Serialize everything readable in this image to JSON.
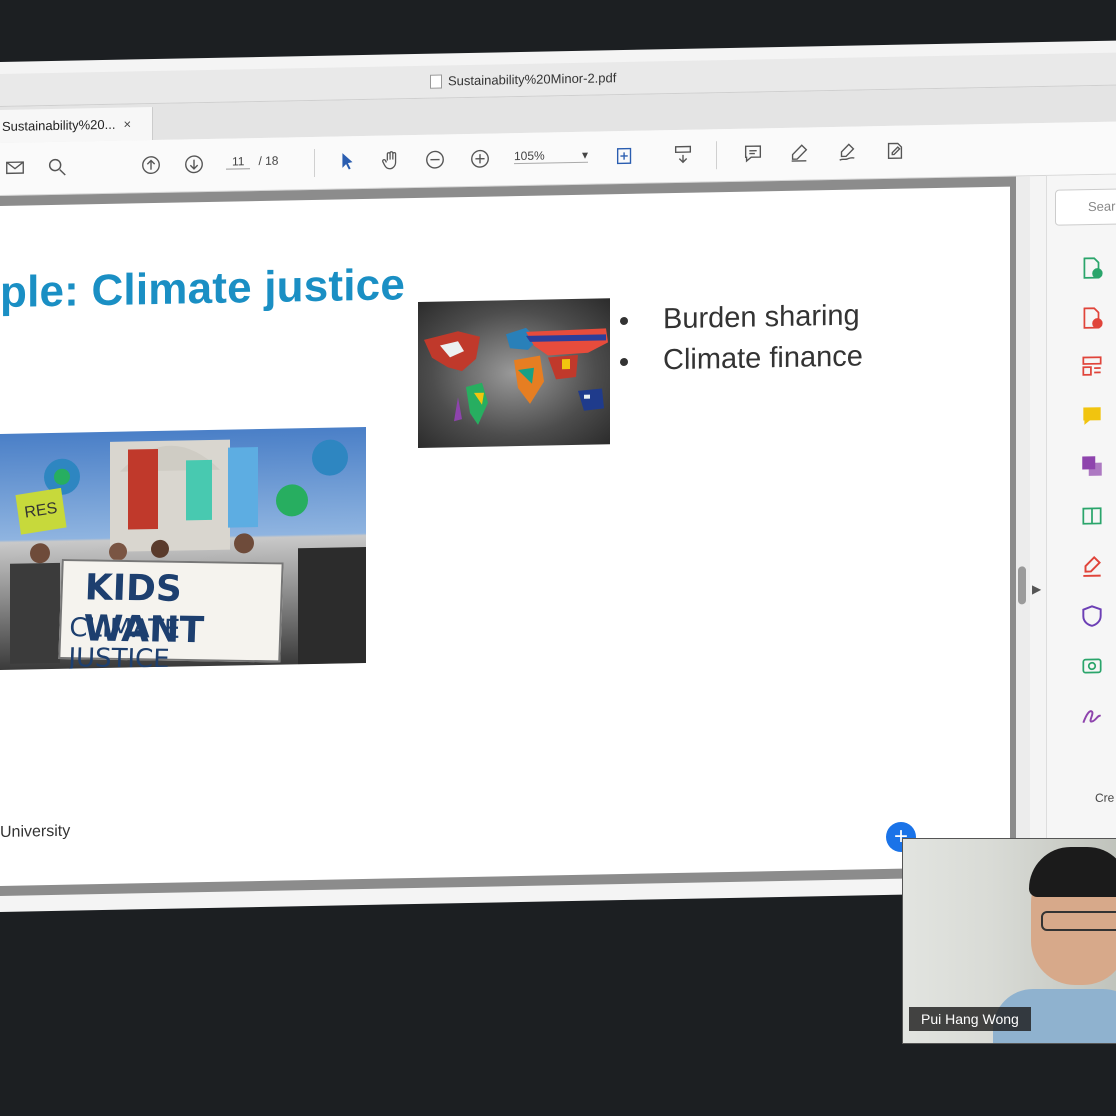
{
  "window": {
    "title": "Sustainability%20Minor-2.pdf"
  },
  "tab": {
    "label": "Sustainability%20...",
    "close": "×"
  },
  "toolbar": {
    "current_page": "11",
    "total_pages": "/ 18",
    "zoom": "105%",
    "zoom_arrow": "▾",
    "icons": [
      "mail-icon",
      "search-zoom-icon",
      "prev-page-icon",
      "next-page-icon",
      "select-cursor-icon",
      "hand-icon",
      "zoom-out-icon",
      "zoom-in-icon",
      "fit-page-icon",
      "scroll-mode-icon",
      "comment-icon",
      "highlight-pen-icon",
      "sign-icon",
      "share-edit-icon"
    ]
  },
  "slide": {
    "title": "ple: Climate justice",
    "bullets": [
      "Burden sharing",
      "Climate finance"
    ],
    "footer": "University",
    "protest_banner": {
      "line1": "KIDS WANT",
      "line2": "CLIMATE JUSTICE"
    },
    "res_sign": "RES"
  },
  "right_panel": {
    "search_placeholder": "Sear",
    "tools": [
      {
        "icon": "create-pdf-icon",
        "color": "#2aa56b"
      },
      {
        "icon": "export-pdf-icon",
        "color": "#e0443a"
      },
      {
        "icon": "organize-pages-icon",
        "color": "#e0443a"
      },
      {
        "icon": "comment-tool-icon",
        "color": "#f1c40f"
      },
      {
        "icon": "combine-files-icon",
        "color": "#8e44ad"
      },
      {
        "icon": "compress-pdf-icon",
        "color": "#2aa56b"
      },
      {
        "icon": "fill-sign-icon",
        "color": "#e0443a"
      },
      {
        "icon": "protect-icon",
        "color": "#6c3fb5"
      },
      {
        "icon": "scan-ocr-icon",
        "color": "#2aa56b"
      },
      {
        "icon": "request-signature-icon",
        "color": "#8e44ad"
      }
    ],
    "footer": "Cre"
  },
  "video": {
    "participant_name": "Pui Hang Wong"
  },
  "colors": {
    "title_blue": "#1a8fc4",
    "add_button": "#1a73e8"
  }
}
